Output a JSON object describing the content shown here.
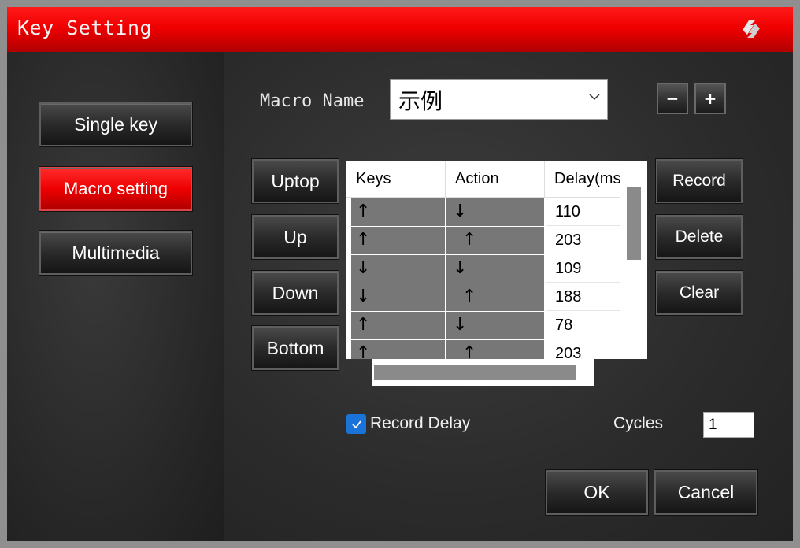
{
  "window": {
    "title": "Key Setting",
    "title_icon": "refresh-arrows-icon"
  },
  "sidebar": {
    "items": [
      {
        "label": "Single key",
        "active": false
      },
      {
        "label": "Macro setting",
        "active": true
      },
      {
        "label": "Multimedia",
        "active": false
      }
    ]
  },
  "macro": {
    "name_label": "Macro Name",
    "name_value": "示例",
    "remove_label": "−",
    "add_label": "+"
  },
  "move_buttons": {
    "uptop": "Uptop",
    "up": "Up",
    "down": "Down",
    "bottom": "Bottom"
  },
  "table": {
    "headers": [
      "Keys",
      "Action",
      "Delay(ms"
    ],
    "rows": [
      {
        "keys": "↑",
        "action": "↓",
        "action_indent": false,
        "delay": "110"
      },
      {
        "keys": "↑",
        "action": "↑",
        "action_indent": true,
        "delay": "203"
      },
      {
        "keys": "↓",
        "action": "↓",
        "action_indent": false,
        "delay": "109"
      },
      {
        "keys": "↓",
        "action": "↑",
        "action_indent": true,
        "delay": "188"
      },
      {
        "keys": "↑",
        "action": "↓",
        "action_indent": false,
        "delay": "78"
      },
      {
        "keys": "↑",
        "action": "↑",
        "action_indent": true,
        "delay": "203"
      }
    ]
  },
  "actions": {
    "record": "Record",
    "delete": "Delete",
    "clear": "Clear"
  },
  "options": {
    "record_delay_label": "Record Delay",
    "record_delay_checked": true,
    "cycles_label": "Cycles",
    "cycles_value": "1"
  },
  "footer": {
    "ok": "OK",
    "cancel": "Cancel"
  },
  "colors": {
    "accent": "#ee0000",
    "checkbox": "#1a73d9"
  }
}
